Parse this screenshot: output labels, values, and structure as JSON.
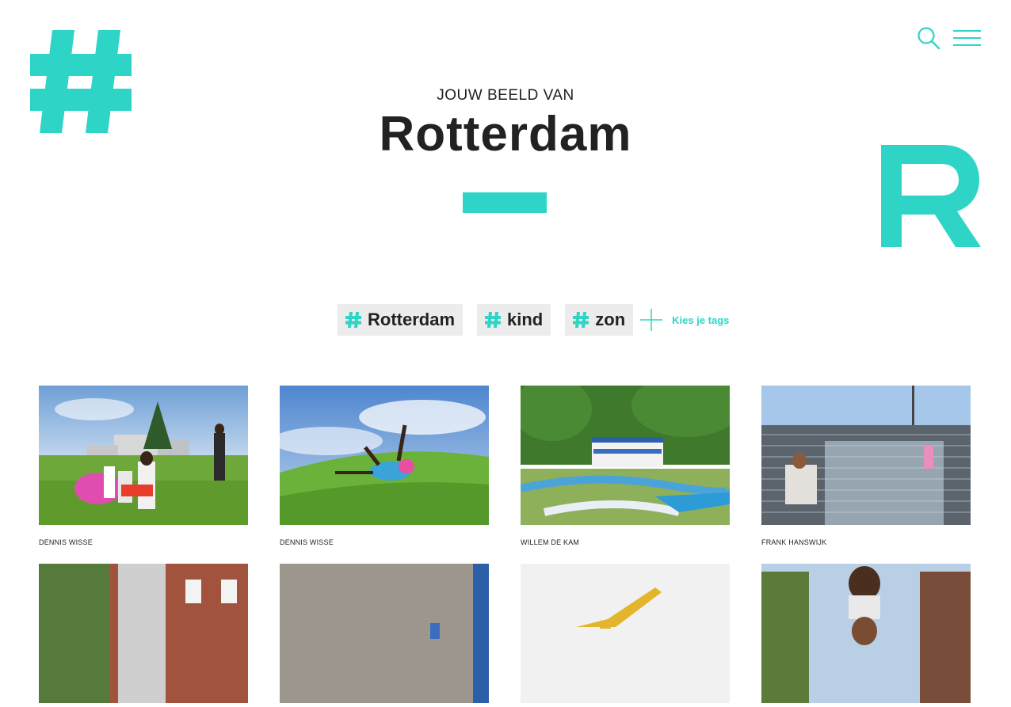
{
  "colors": {
    "accent": "#2ed4c6",
    "tag_bg": "#ececec",
    "text": "#222222"
  },
  "header": {
    "subtitle": "JOUW BEELD VAN",
    "title": "Rotterdam"
  },
  "nav": {
    "search_icon": "search-icon",
    "menu_icon": "menu-icon"
  },
  "tags": [
    {
      "label": "Rotterdam"
    },
    {
      "label": "kind"
    },
    {
      "label": "zon"
    }
  ],
  "add_tags_label": "Kies je tags",
  "photos": [
    {
      "credit": "DENNIS WISSE",
      "subject": "family picnic on grass"
    },
    {
      "credit": "DENNIS WISSE",
      "subject": "girl tumbling on grass"
    },
    {
      "credit": "WILLEM DE KAM",
      "subject": "RC track with stand"
    },
    {
      "credit": "FRANK HANSWIJK",
      "subject": "people on waterfall stairs"
    },
    {
      "credit": "",
      "subject": "brick building with trees"
    },
    {
      "credit": "",
      "subject": "brick wall"
    },
    {
      "credit": "",
      "subject": "excavator"
    },
    {
      "credit": "",
      "subject": "father carrying child"
    }
  ]
}
